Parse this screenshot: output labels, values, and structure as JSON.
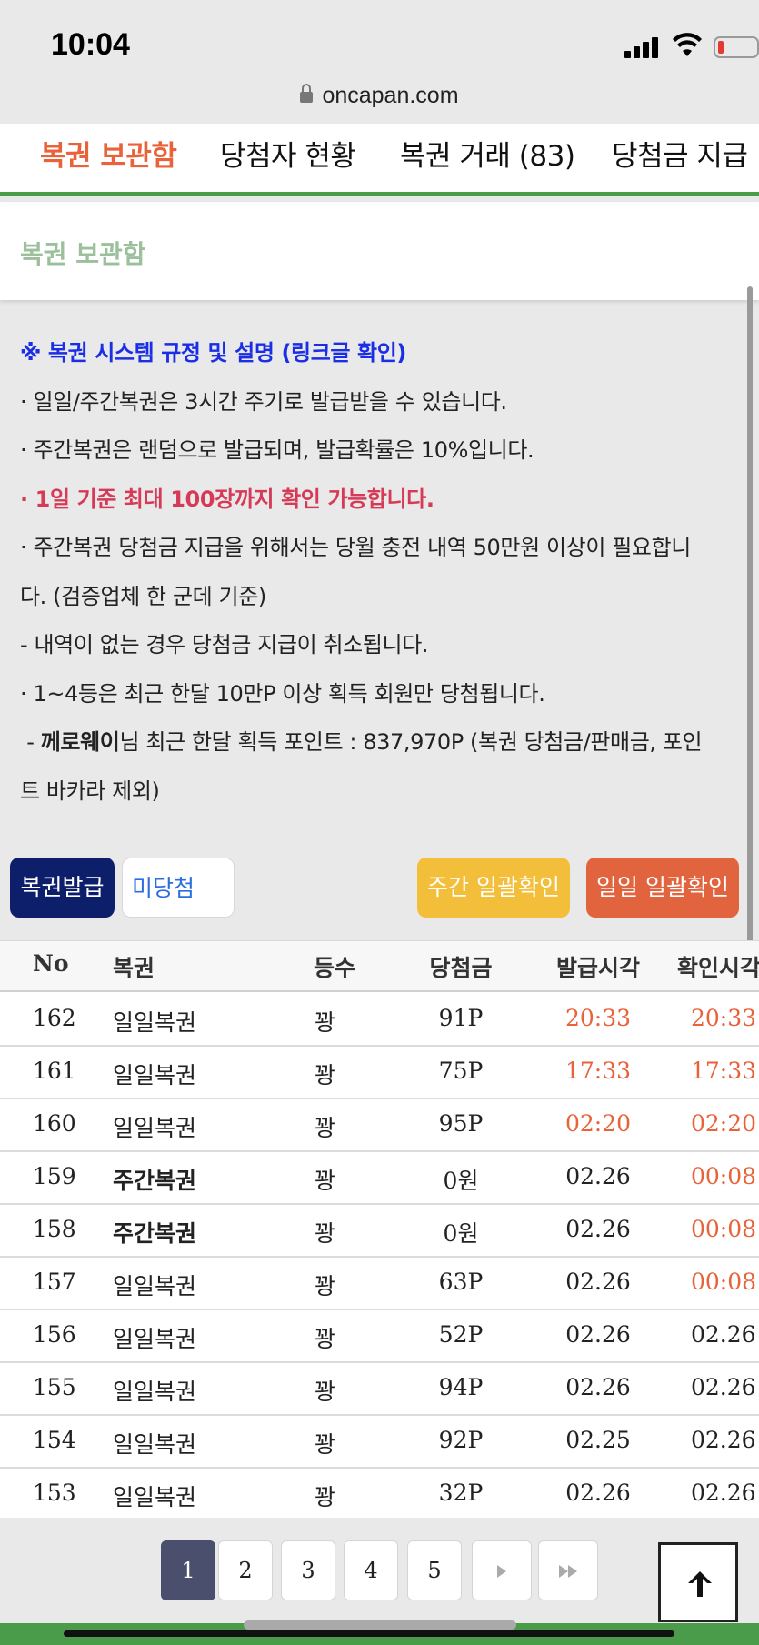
{
  "status": {
    "time": "10:04",
    "url": "oncapan.com",
    "colors": {
      "battery": "#e53935"
    }
  },
  "tabs": [
    {
      "label": "복권 보관함",
      "active": true
    },
    {
      "label": "당첨자 현황",
      "active": false
    },
    {
      "label": "복권 거래 (83)",
      "active": false
    },
    {
      "label": "당첨금 지급",
      "active": false
    }
  ],
  "section": {
    "title": "복권 보관함"
  },
  "notice": {
    "heading": "※ 복권 시스템 규정 및 설명 (링크글 확인)",
    "lines": [
      "· 일일/주간복권은 3시간 주기로 발급받을 수 있습니다.",
      "· 주간복권은 랜덤으로 발급되며, 발급확률은 10%입니다.",
      "· 1일 기준 최대 100장까지 확인 가능합니다.",
      "· 주간복권 당첨금 지급을 위해서는 당월 충전 내역 50만원 이상이 필요합니",
      "다. (검증업체 한 군데 기준)",
      "- 내역이 없는 경우 당첨금 지급이 취소됩니다.",
      "· 1~4등은 최근 한달 10만P 이상 획득 회원만 당첨됩니다.",
      "- 께로웨이님 최근 한달 획득 포인트 : 837,970P (복권 당첨금/판매금, 포인",
      "트 바카라 제외)"
    ],
    "user_name": "께로웨이",
    "user_suffix": "님 최근 한달 획득 포인트 : 837,970P (복권 당첨금/판매금, 포인"
  },
  "actions": {
    "issue": "복권발급",
    "filter": "미당첨",
    "weekly_check": "주간 일괄확인",
    "daily_check": "일일 일괄확인"
  },
  "table": {
    "headers": [
      "No",
      "복권",
      "등수",
      "당첨금",
      "발급시각",
      "확인시각"
    ],
    "rows": [
      {
        "no": "162",
        "name": "일일복권",
        "rank": "꽝",
        "prize": "91P",
        "issued": "20:33",
        "checked": "20:33",
        "weekly": false
      },
      {
        "no": "161",
        "name": "일일복권",
        "rank": "꽝",
        "prize": "75P",
        "issued": "17:33",
        "checked": "17:33",
        "weekly": false
      },
      {
        "no": "160",
        "name": "일일복권",
        "rank": "꽝",
        "prize": "95P",
        "issued": "02:20",
        "checked": "02:20",
        "weekly": false
      },
      {
        "no": "159",
        "name": "주간복권",
        "rank": "꽝",
        "prize": "0원",
        "issued": "02.26",
        "checked": "00:08",
        "weekly": true
      },
      {
        "no": "158",
        "name": "주간복권",
        "rank": "꽝",
        "prize": "0원",
        "issued": "02.26",
        "checked": "00:08",
        "weekly": true
      },
      {
        "no": "157",
        "name": "일일복권",
        "rank": "꽝",
        "prize": "63P",
        "issued": "02.26",
        "checked": "00:08",
        "weekly": false
      },
      {
        "no": "156",
        "name": "일일복권",
        "rank": "꽝",
        "prize": "52P",
        "issued": "02.26",
        "checked": "02.26",
        "weekly": false
      },
      {
        "no": "155",
        "name": "일일복권",
        "rank": "꽝",
        "prize": "94P",
        "issued": "02.26",
        "checked": "02.26",
        "weekly": false
      },
      {
        "no": "154",
        "name": "일일복권",
        "rank": "꽝",
        "prize": "92P",
        "issued": "02.25",
        "checked": "02.26",
        "weekly": false
      },
      {
        "no": "153",
        "name": "일일복권",
        "rank": "꽝",
        "prize": "32P",
        "issued": "02.26",
        "checked": "02.26",
        "weekly": false
      }
    ]
  },
  "pagination": {
    "pages": [
      "1",
      "2",
      "3",
      "4",
      "5"
    ],
    "current": "1"
  },
  "colors": {
    "accent_orange": "#e8623a",
    "navy": "#0d1f6b",
    "yellow": "#f3bf3b",
    "green_bar": "#4a9b4a",
    "notice_blue": "#1a2ee6",
    "notice_red": "#d63a57"
  }
}
